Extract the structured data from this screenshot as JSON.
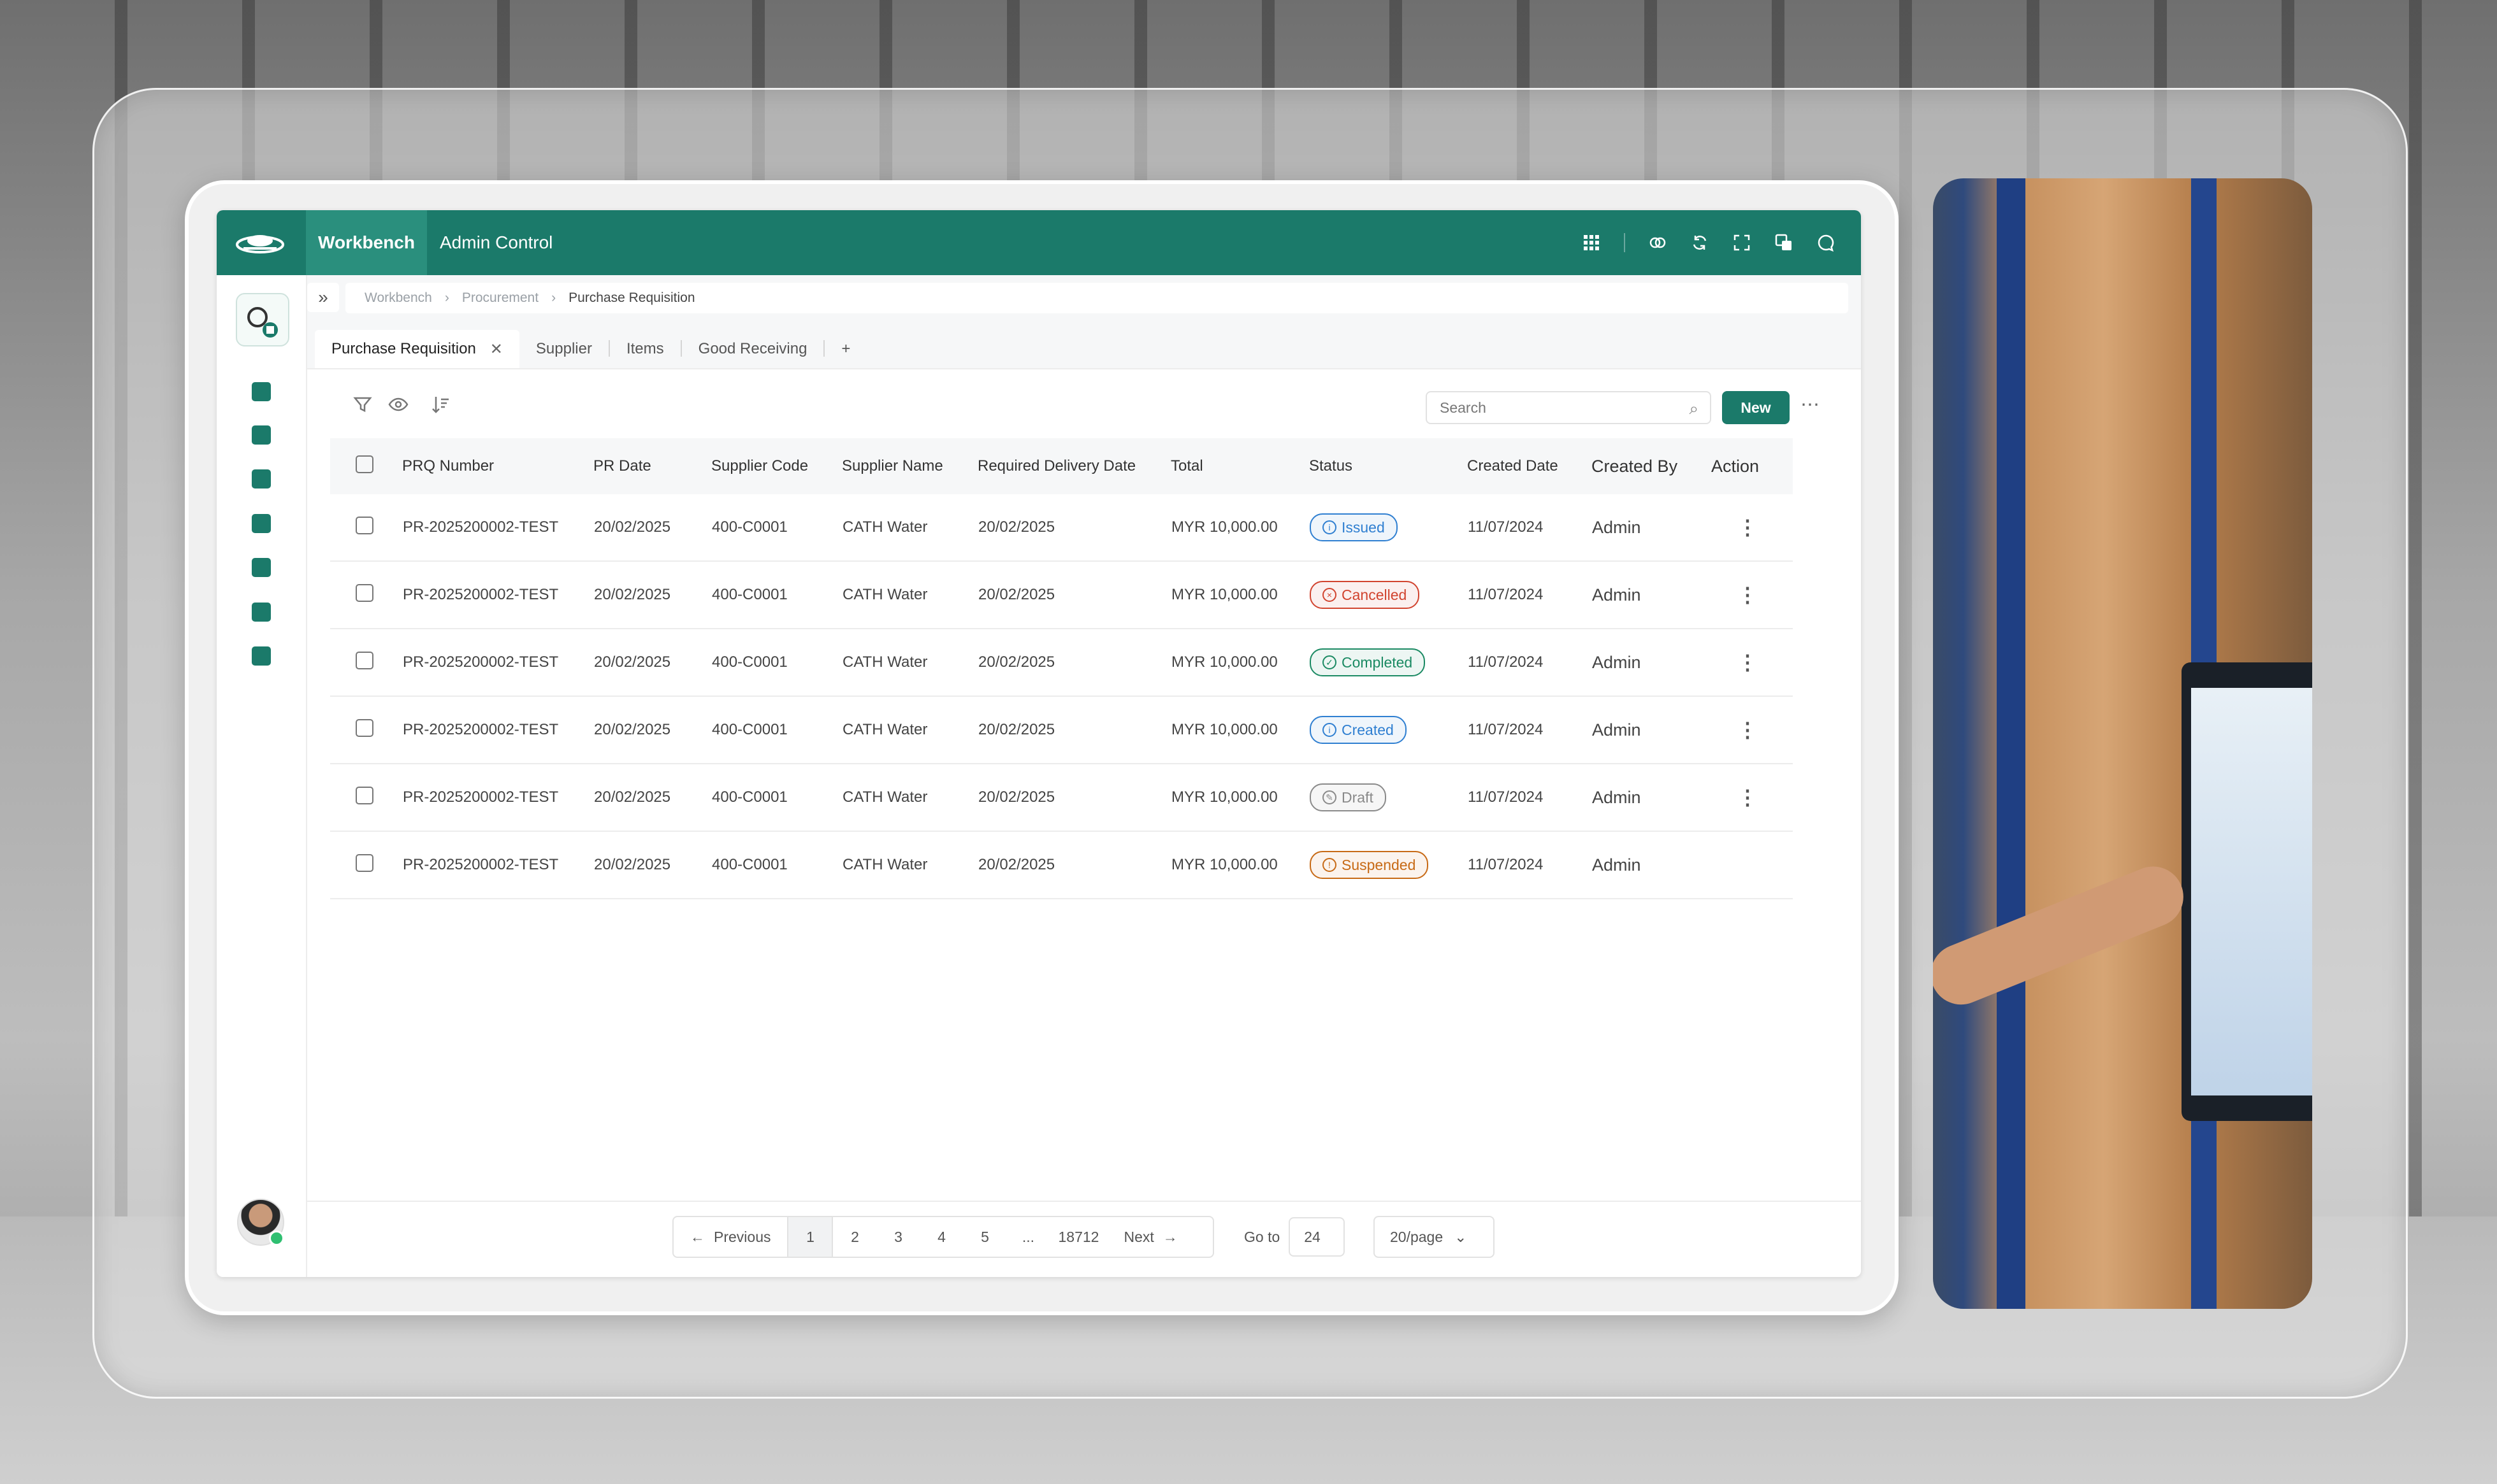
{
  "topbar": {
    "active_nav": "Workbench",
    "nav": "Admin Control",
    "icons": [
      "grid-icon",
      "link-icon",
      "refresh-icon",
      "fullscreen-icon",
      "translate-icon",
      "chat-icon"
    ]
  },
  "breadcrumb": [
    "Workbench",
    "Procurement",
    "Purchase Requisition"
  ],
  "tabs": [
    {
      "label": "Purchase Requisition",
      "active": true
    },
    {
      "label": "Supplier"
    },
    {
      "label": "Items"
    },
    {
      "label": "Good Receiving"
    },
    {
      "label": "+"
    }
  ],
  "toolbar": {
    "search_placeholder": "Search",
    "new_label": "New",
    "more": "⋯"
  },
  "table": {
    "headers": [
      "PRQ Number",
      "PR Date",
      "Supplier Code",
      "Supplier Name",
      "Required Delivery Date",
      "Total",
      "Status",
      "Created Date",
      "Created By",
      "Action"
    ],
    "rows": [
      {
        "prq": "PR-2025200002-TEST",
        "pr_date": "20/02/2025",
        "supplier_code": "400-C0001",
        "supplier_name": "CATH Water",
        "delivery": "20/02/2025",
        "total": "MYR 10,000.00",
        "status": "Issued",
        "created": "11/07/2024",
        "by": "Admin",
        "action": "⋮"
      },
      {
        "prq": "PR-2025200002-TEST",
        "pr_date": "20/02/2025",
        "supplier_code": "400-C0001",
        "supplier_name": "CATH Water",
        "delivery": "20/02/2025",
        "total": "MYR 10,000.00",
        "status": "Cancelled",
        "created": "11/07/2024",
        "by": "Admin",
        "action": "⋮"
      },
      {
        "prq": "PR-2025200002-TEST",
        "pr_date": "20/02/2025",
        "supplier_code": "400-C0001",
        "supplier_name": "CATH Water",
        "delivery": "20/02/2025",
        "total": "MYR 10,000.00",
        "status": "Completed",
        "created": "11/07/2024",
        "by": "Admin",
        "action": "⋮"
      },
      {
        "prq": "PR-2025200002-TEST",
        "pr_date": "20/02/2025",
        "supplier_code": "400-C0001",
        "supplier_name": "CATH Water",
        "delivery": "20/02/2025",
        "total": "MYR 10,000.00",
        "status": "Created",
        "created": "11/07/2024",
        "by": "Admin",
        "action": "⋮"
      },
      {
        "prq": "PR-2025200002-TEST",
        "pr_date": "20/02/2025",
        "supplier_code": "400-C0001",
        "supplier_name": "CATH Water",
        "delivery": "20/02/2025",
        "total": "MYR 10,000.00",
        "status": "Draft",
        "created": "11/07/2024",
        "by": "Admin",
        "action": "⋮"
      },
      {
        "prq": "PR-2025200002-TEST",
        "pr_date": "20/02/2025",
        "supplier_code": "400-C0001",
        "supplier_name": "CATH Water",
        "delivery": "20/02/2025",
        "total": "MYR 10,000.00",
        "status": "Suspended",
        "created": "11/07/2024",
        "by": "Admin",
        "action": ""
      }
    ]
  },
  "status_colors": {
    "Issued": {
      "color": "#2f7fd1",
      "icon": "i"
    },
    "Cancelled": {
      "color": "#d1442f",
      "icon": "×"
    },
    "Completed": {
      "color": "#1b8a63",
      "icon": "✓"
    },
    "Created": {
      "color": "#2f7fd1",
      "icon": "i"
    },
    "Draft": {
      "color": "#8a8a8a",
      "icon": "✎"
    },
    "Suspended": {
      "color": "#c76a16",
      "icon": "!"
    }
  },
  "pagination": {
    "previous": "Previous",
    "pages": [
      "1",
      "2",
      "3",
      "4",
      "5",
      "...",
      "18712"
    ],
    "next": "Next",
    "goto_label": "Go to",
    "goto_value": "24",
    "per_page": "20/page"
  },
  "colors": {
    "brand": "#1b7a6a",
    "brand_active": "#2a8f7d"
  }
}
